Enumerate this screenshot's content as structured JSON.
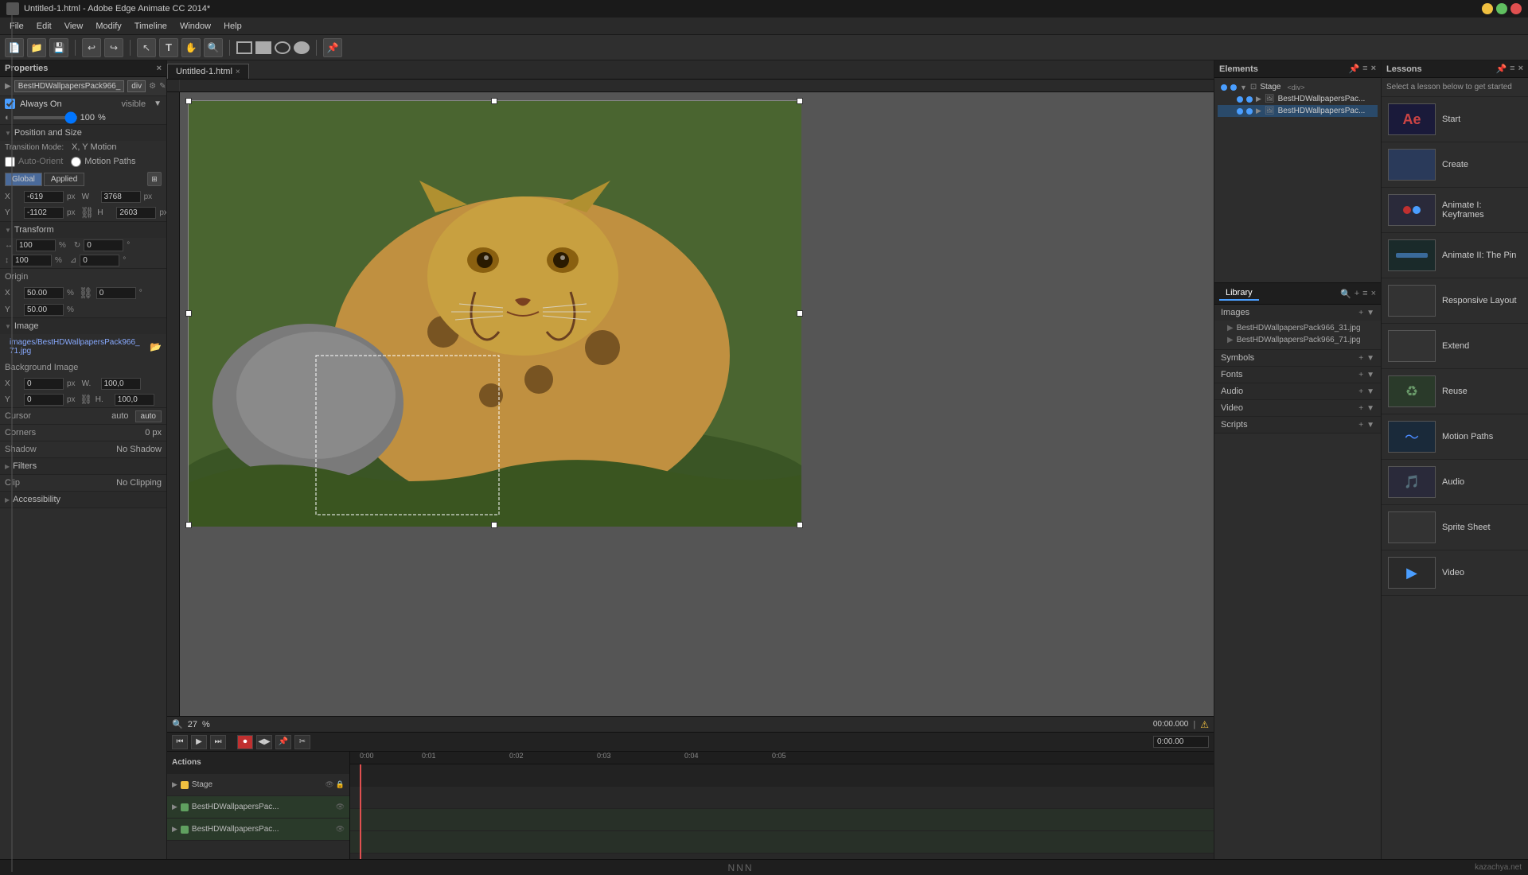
{
  "app": {
    "title": "Untitled-1.html - Adobe Edge Animate CC 2014*",
    "icon": "ae"
  },
  "menu": {
    "items": [
      "File",
      "Edit",
      "View",
      "Modify",
      "Timeline",
      "Window",
      "Help"
    ]
  },
  "properties_panel": {
    "title": "Properties",
    "element_name": "BestHDWallpapersPack966_",
    "element_tag": "div",
    "always_on_label": "Always On",
    "visible_label": "visible",
    "opacity": "100",
    "opacity_unit": "%",
    "position_size_label": "Position and Size",
    "transition_mode_label": "Transition Mode:",
    "transition_xy": "X, Y Motion",
    "auto_orient": "Auto-Orient",
    "motion_paths": "Motion Paths",
    "global_btn": "Global",
    "applied_btn": "Applied",
    "x_label": "X",
    "x_value": "-619",
    "x_unit": "px",
    "w_label": "W",
    "w_value": "3768",
    "w_unit": "px",
    "y_label": "Y",
    "y_value": "-1102",
    "y_unit": "px",
    "h_label": "H",
    "h_value": "2603",
    "h_unit": "px",
    "transform_label": "Transform",
    "scale_x": "100",
    "scale_y": "100",
    "rotate": "0",
    "skew": "0",
    "origin_label": "Origin",
    "origin_x": "50.00",
    "origin_y": "50.00",
    "origin_unit": "%",
    "image_label": "Image",
    "image_path": "images/BestHDWallpapersPack966_71.jpg",
    "bg_image_label": "Background Image",
    "bg_x": "0",
    "bg_y": "0",
    "bg_w": "100.0",
    "bg_h": "100.0",
    "cursor_label": "Cursor",
    "cursor_value": "auto",
    "corners_label": "Corners",
    "corners_value": "0 px",
    "shadow_label": "Shadow",
    "shadow_value": "No Shadow",
    "filters_label": "Filters",
    "clip_label": "Clip",
    "clip_value": "No Clipping",
    "accessibility_label": "Accessibility"
  },
  "canvas": {
    "tab_name": "Untitled-1.html",
    "zoom": "27",
    "zoom_unit": "%",
    "time": "00:00.000",
    "warning": true
  },
  "elements_panel": {
    "title": "Elements",
    "stage_label": "Stage",
    "stage_tag": "div",
    "item1": "BestHDWallpapersPac...",
    "item2": "BestHDWallpapersPac..."
  },
  "library_panel": {
    "title": "Library",
    "sections": {
      "images": {
        "label": "Images",
        "files": [
          "BestHDWallpapersPack966_31.jpg",
          "BestHDWallpapersPack966_71.jpg"
        ]
      },
      "symbols": {
        "label": "Symbols"
      },
      "fonts": {
        "label": "Fonts"
      },
      "audio": {
        "label": "Audio"
      },
      "video": {
        "label": "Video"
      },
      "scripts": {
        "label": "Scripts"
      }
    }
  },
  "lessons_panel": {
    "title": "Lessons",
    "description": "Select a lesson below to get started",
    "items": [
      {
        "label": "Start",
        "thumb_type": "ae"
      },
      {
        "label": "Create",
        "thumb_type": "blue"
      },
      {
        "label": "Animate I: Keyframes",
        "thumb_type": "multi"
      },
      {
        "label": "Animate II: The Pin",
        "thumb_type": "timeline"
      },
      {
        "label": "Responsive Layout",
        "thumb_type": "blank"
      },
      {
        "label": "Extend",
        "thumb_type": "blank"
      },
      {
        "label": "Reuse",
        "thumb_type": "icons"
      },
      {
        "label": "Motion Paths",
        "thumb_type": "motion"
      },
      {
        "label": "Audio",
        "thumb_type": "audio"
      },
      {
        "label": "Sprite Sheet",
        "thumb_type": "sprite"
      },
      {
        "label": "Video",
        "thumb_type": "video"
      }
    ]
  },
  "timeline": {
    "time_display": "00:00.000",
    "tracks": [
      "Actions",
      "Stage",
      "BestHDWallpapersPac...",
      "BestHDWallpapersPac..."
    ],
    "markers": [
      "0:01",
      "0:02",
      "0:03",
      "0:04",
      "0:05"
    ]
  },
  "status_bar": {
    "brand": "NNN",
    "right_label": "kazachya.net"
  }
}
